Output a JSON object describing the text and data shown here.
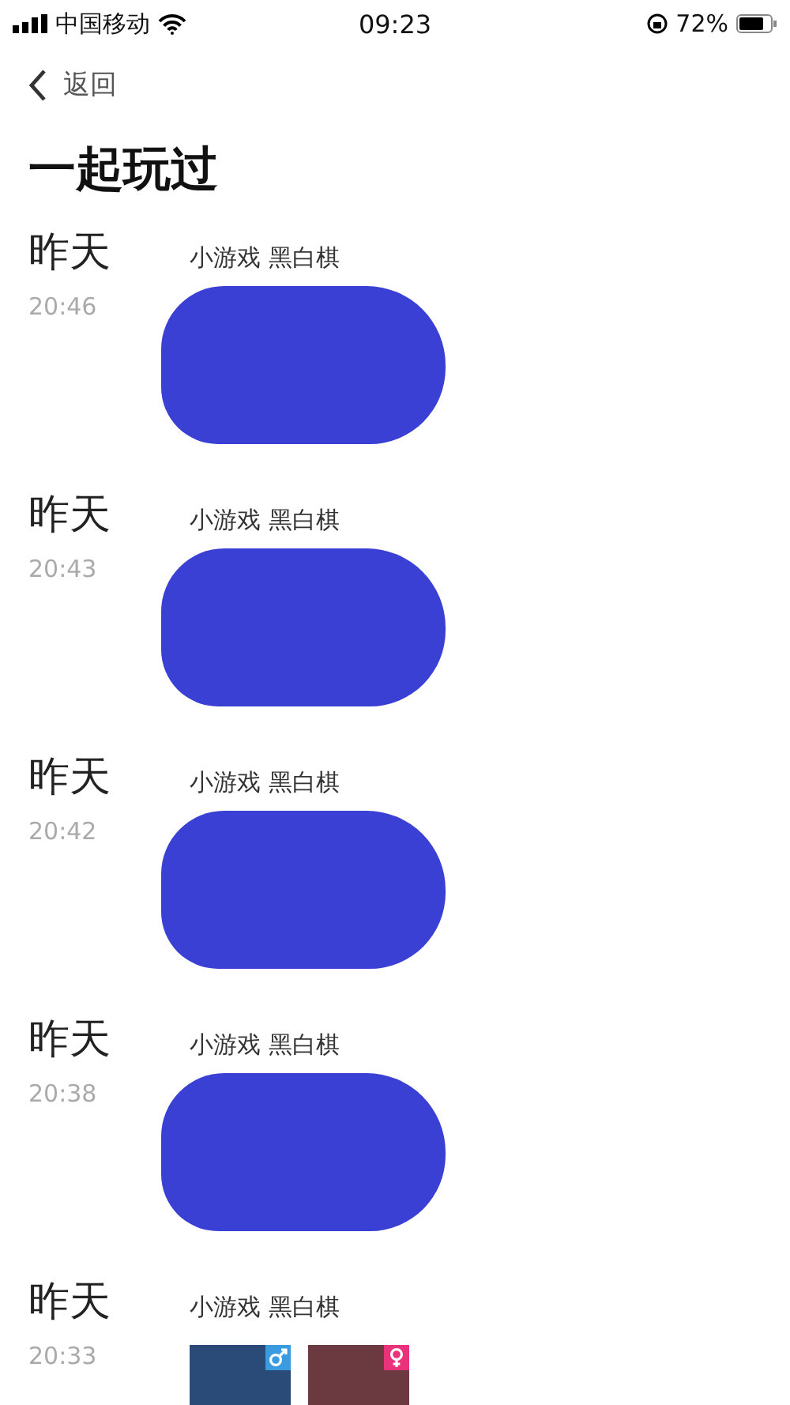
{
  "status_bar": {
    "carrier": "中国移动",
    "time": "09:23",
    "battery": "72%"
  },
  "nav": {
    "back": "返回"
  },
  "title": "一起玩过",
  "entries": [
    {
      "day": "昨天",
      "time": "20:46",
      "game": "小游戏 黑白棋",
      "redacted": true
    },
    {
      "day": "昨天",
      "time": "20:43",
      "game": "小游戏 黑白棋",
      "redacted": true
    },
    {
      "day": "昨天",
      "time": "20:42",
      "game": "小游戏 黑白棋",
      "redacted": true
    },
    {
      "day": "昨天",
      "time": "20:38",
      "game": "小游戏 黑白棋",
      "redacted": true
    },
    {
      "day": "昨天",
      "time": "20:33",
      "game": "小游戏 黑白棋",
      "redacted": false,
      "players": [
        {
          "kind": "male"
        },
        {
          "kind": "female"
        }
      ]
    }
  ]
}
